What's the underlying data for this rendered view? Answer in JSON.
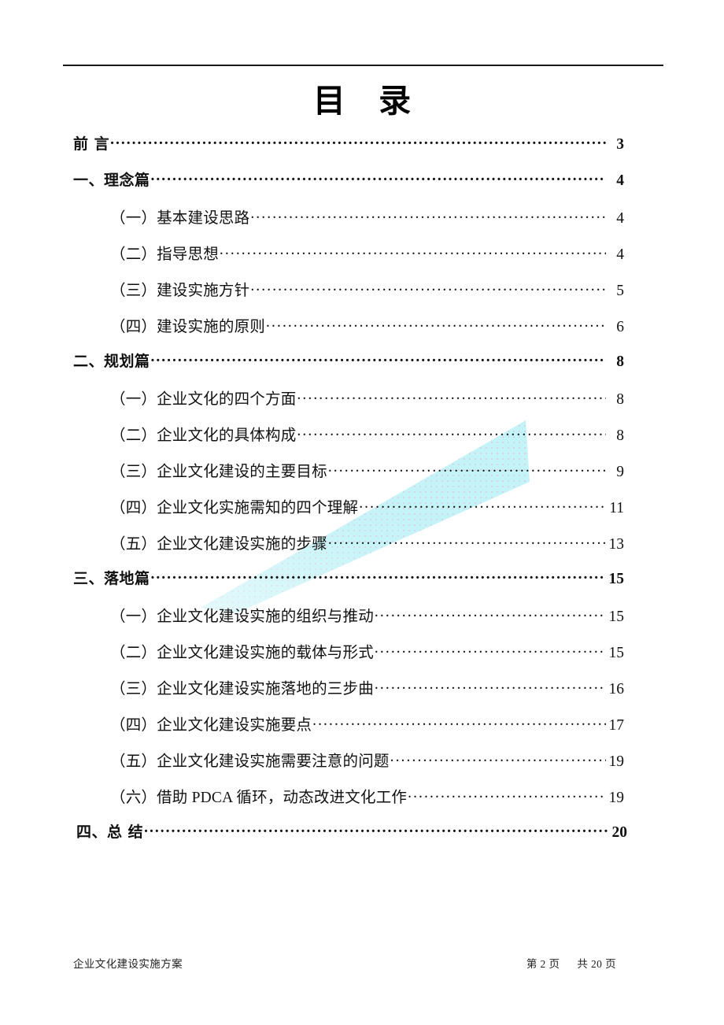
{
  "document": {
    "title": "目 录",
    "footer": {
      "left_text": "企业文化建设实施方案",
      "page_label": "第 2 页",
      "total_label": "共 20 页"
    }
  },
  "theme": {
    "text_color": "#111111",
    "rule_color": "#1a1a1a",
    "watermark_color": "#bdf2f7",
    "watermark_dot_color": "#f2a8c8",
    "page_background": "#ffffff"
  },
  "toc": {
    "entries": [
      {
        "level": 1,
        "label": "前 言",
        "page": "3"
      },
      {
        "level": 1,
        "label": "一、理念篇",
        "page": "4"
      },
      {
        "level": 2,
        "label": "（一）基本建设思路",
        "page": "4"
      },
      {
        "level": 2,
        "label": "（二）指导思想",
        "page": "4"
      },
      {
        "level": 2,
        "label": "（三）建设实施方针",
        "page": "5"
      },
      {
        "level": 2,
        "label": "（四）建设实施的原则",
        "page": "6"
      },
      {
        "level": 1,
        "label": "二、规划篇",
        "page": "8"
      },
      {
        "level": 2,
        "label": "（一）企业文化的四个方面",
        "page": "8"
      },
      {
        "level": 2,
        "label": "（二）企业文化的具体构成",
        "page": "8"
      },
      {
        "level": 2,
        "label": "（三）企业文化建设的主要目标",
        "page": "9"
      },
      {
        "level": 2,
        "label": "（四）企业文化实施需知的四个理解",
        "page": "11"
      },
      {
        "level": 2,
        "label": "（五）企业文化建设实施的步骤",
        "page": "13"
      },
      {
        "level": 1,
        "label": "三、落地篇",
        "page": "15"
      },
      {
        "level": 2,
        "label": "（一）企业文化建设实施的组织与推动",
        "page": "15"
      },
      {
        "level": 2,
        "label": "（二）企业文化建设实施的载体与形式",
        "page": "15"
      },
      {
        "level": 2,
        "label": "（三）企业文化建设实施落地的三步曲",
        "page": "16"
      },
      {
        "level": 2,
        "label": "（四）企业文化建设实施要点",
        "page": "17"
      },
      {
        "level": 2,
        "label": "（五）企业文化建设实施需要注意的问题",
        "page": "19"
      },
      {
        "level": 2,
        "label": "（六）借助 PDCA 循环，动态改进文化工作",
        "page": "19"
      },
      {
        "level": 1,
        "label": "四、总 结",
        "page": "20",
        "last": true
      }
    ]
  }
}
